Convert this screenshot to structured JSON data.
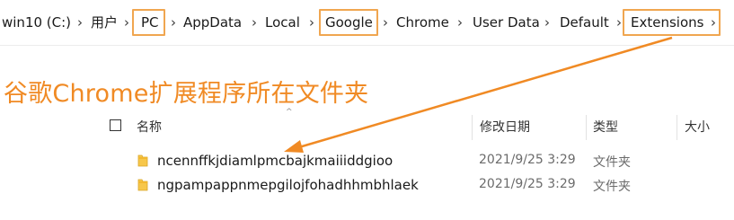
{
  "breadcrumb": {
    "items": [
      {
        "label": "win10 (C:)"
      },
      {
        "label": "用户"
      },
      {
        "label": "PC"
      },
      {
        "label": "AppData"
      },
      {
        "label": "Local"
      },
      {
        "label": "Google"
      },
      {
        "label": "Chrome"
      },
      {
        "label": "User Data"
      },
      {
        "label": "Default"
      },
      {
        "label": "Extensions"
      }
    ],
    "separator": ">"
  },
  "annotation": {
    "text": "谷歌Chrome扩展程序所在文件夹",
    "color": "#f08a24",
    "highlight_color": "#f0a650"
  },
  "list": {
    "sort_indicator": "^",
    "columns": {
      "name": "名称",
      "date": "修改日期",
      "type": "类型",
      "size": "大小"
    },
    "rows": [
      {
        "name": "ncennffkjdiamlpmcbajkmaiiiddgioo",
        "date": "2021/9/25 3:29",
        "type": "文件夹",
        "icon": "folder-icon"
      },
      {
        "name": "ngpampappnmepgilojfohadhhmbhlaek",
        "date": "2021/9/25 3:29",
        "type": "文件夹",
        "icon": "folder-icon"
      }
    ]
  }
}
